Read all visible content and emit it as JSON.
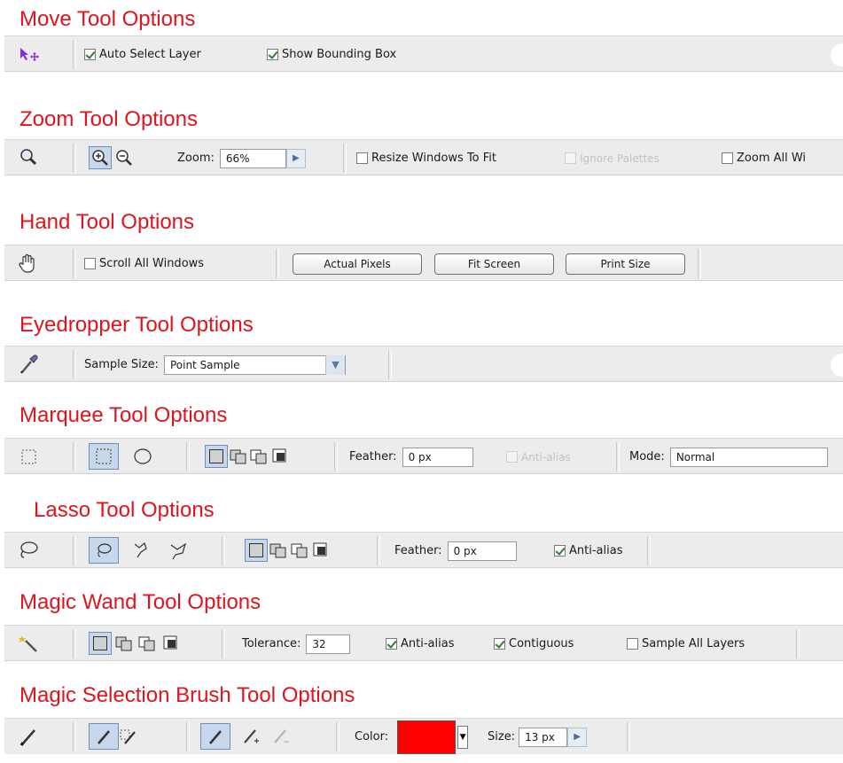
{
  "move": {
    "title": "Move Tool Options",
    "tool_icon": "move-tool-icon",
    "auto_select_layer": "Auto Select Layer",
    "show_bounding_box": "Show Bounding Box"
  },
  "zoom": {
    "title": "Zoom Tool Options",
    "zoom_label": "Zoom:",
    "zoom_value": "66%",
    "resize_windows": "Resize Windows To Fit",
    "ignore_palettes": "Ignore Palettes",
    "zoom_all": "Zoom All Wi"
  },
  "hand": {
    "title": "Hand Tool Options",
    "scroll_all": "Scroll All Windows",
    "actual_pixels": "Actual Pixels",
    "fit_screen": "Fit Screen",
    "print_size": "Print Size"
  },
  "eyedropper": {
    "title": "Eyedropper Tool Options",
    "sample_size_label": "Sample Size:",
    "sample_size_value": "Point Sample"
  },
  "marquee": {
    "title": "Marquee Tool Options",
    "feather_label": "Feather:",
    "feather_value": "0 px",
    "anti_alias": "Anti-alias",
    "mode_label": "Mode:",
    "mode_value": "Normal"
  },
  "lasso": {
    "title": "Lasso Tool Options",
    "feather_label": "Feather:",
    "feather_value": "0 px",
    "anti_alias": "Anti-alias"
  },
  "wand": {
    "title": "Magic Wand Tool Options",
    "tolerance_label": "Tolerance:",
    "tolerance_value": "32",
    "anti_alias": "Anti-alias",
    "contiguous": "Contiguous",
    "sample_all_layers": "Sample All Layers"
  },
  "brush": {
    "title": "Magic Selection Brush Tool Options",
    "color_label": "Color:",
    "color_value": "#ff0000",
    "size_label": "Size:",
    "size_value": "13 px"
  },
  "colors": {
    "title_red": "#e0141e",
    "bar_gray": "#ececec",
    "selected_blue": "#c8d8ec"
  }
}
